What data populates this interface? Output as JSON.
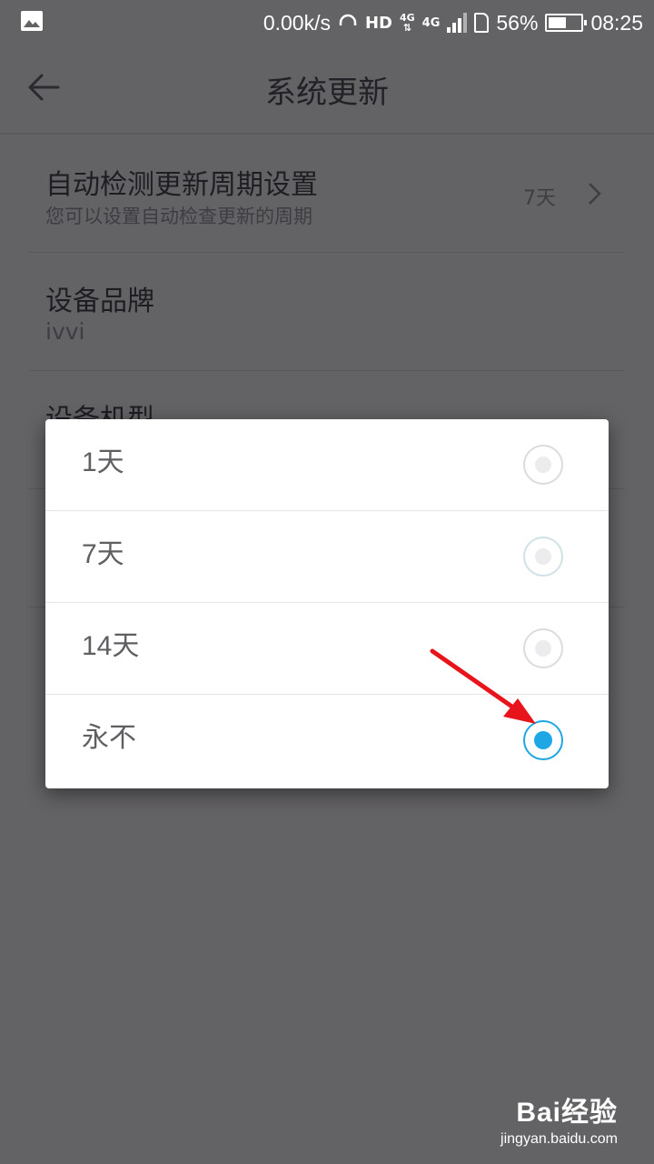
{
  "status_bar": {
    "speed": "0.00k/s",
    "hd": "HD",
    "net_top": "4G",
    "net_bottom": "4G",
    "battery_pct": "56%",
    "battery_level": 0.56,
    "time": "08:25"
  },
  "header": {
    "title": "系统更新",
    "back_icon": "arrow-left-icon"
  },
  "settings": {
    "auto_check": {
      "label": "自动检测更新周期设置",
      "description": "您可以设置自动检查更新的周期",
      "value": "7天"
    },
    "brand": {
      "label": "设备品牌",
      "value": "ivvi"
    },
    "model": {
      "label": "设备机型"
    }
  },
  "dialog": {
    "options": [
      {
        "label": "1天",
        "selected": false
      },
      {
        "label": "7天",
        "selected": false
      },
      {
        "label": "14天",
        "selected": false
      },
      {
        "label": "永不",
        "selected": true
      }
    ]
  },
  "colors": {
    "accent": "#1ea7e4",
    "annotation_arrow": "#e8141c",
    "overlay_bg": "#636265"
  },
  "watermark": {
    "brand": "Bai经验",
    "url": "jingyan.baidu.com"
  }
}
